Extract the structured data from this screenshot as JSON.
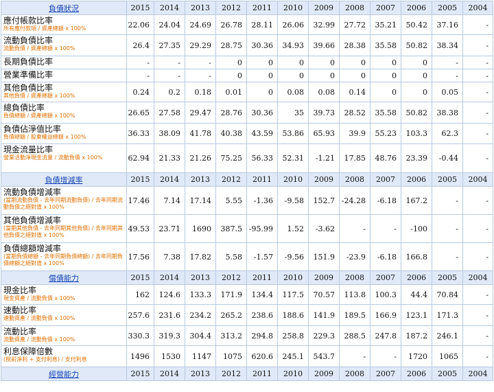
{
  "years": [
    "2015",
    "2014",
    "2013",
    "2012",
    "2011",
    "2010",
    "2009",
    "2008",
    "2007",
    "2006",
    "2005",
    "2004"
  ],
  "sections": [
    {
      "title": "負債狀況",
      "rows": [
        {
          "label": "應付帳款比率",
          "desc": "所有應付款項 / 資產總額 x 100%",
          "values": [
            "22.06",
            "24.04",
            "24.69",
            "26.78",
            "28.11",
            "26.06",
            "32.99",
            "27.72",
            "35.21",
            "50.42",
            "37.16",
            "-"
          ]
        },
        {
          "label": "流動負債比率",
          "desc": "流動負債 / 資產總額 x 100%",
          "values": [
            "26.4",
            "27.35",
            "29.29",
            "28.75",
            "30.36",
            "34.93",
            "39.66",
            "28.38",
            "35.58",
            "50.82",
            "38.34",
            "-"
          ]
        },
        {
          "label": "長期負債比率",
          "desc": "",
          "values": [
            "-",
            "-",
            "-",
            "0",
            "0",
            "0",
            "0",
            "0",
            "0",
            "0",
            "-",
            "-"
          ]
        },
        {
          "label": "營業準備比率",
          "desc": "",
          "values": [
            "-",
            "-",
            "-",
            "0",
            "0",
            "0",
            "0",
            "0",
            "0",
            "0",
            "-",
            "-"
          ]
        },
        {
          "label": "其他負債比率",
          "desc": "其他負債 / 資產總額 x 100%",
          "values": [
            "0.24",
            "0.2",
            "0.18",
            "0.01",
            "0",
            "0.08",
            "0.08",
            "0.14",
            "0",
            "0",
            "0.05",
            "-"
          ]
        },
        {
          "label": "總負債比率",
          "desc": "負債總額 / 資產總額 x 100%",
          "values": [
            "26.65",
            "27.58",
            "29.47",
            "28.76",
            "30.36",
            "35",
            "39.73",
            "28.52",
            "35.58",
            "50.82",
            "38.38",
            "-"
          ]
        },
        {
          "label": "負債佔淨值比率",
          "desc": "負債總額 / 股東權益總額 x 100%",
          "values": [
            "36.33",
            "38.09",
            "41.78",
            "40.38",
            "43.59",
            "53.86",
            "65.93",
            "39.9",
            "55.23",
            "103.3",
            "62.3",
            "-"
          ]
        },
        {
          "label": "現金流量比率",
          "desc": "營業活動淨現金流量 / 流動負債 x 100%",
          "values": [
            "62.94",
            "21.33",
            "21.26",
            "75.25",
            "56.33",
            "52.31",
            "-1.21",
            "17.85",
            "48.76",
            "23.39",
            "-0.44",
            "-"
          ]
        }
      ]
    },
    {
      "title": "負債增減率",
      "rows": [
        {
          "label": "流動負債增減率",
          "desc": "(當期流動負債 - 去年同期流動負債) / 去年同期流動負債之絕對值 x 100%",
          "values": [
            "17.46",
            "7.14",
            "17.14",
            "5.55",
            "-1.36",
            "-9.58",
            "152.7",
            "-24.28",
            "-6.18",
            "167.2",
            "-",
            "-"
          ]
        },
        {
          "label": "其他負債增減率",
          "desc": "(當期其他負債 - 去年同期其他負債) / 去年同期其他負債之絕對值 x 100%",
          "values": [
            "49.53",
            "23.71",
            "1690",
            "387.5",
            "-95.99",
            "1.52",
            "-3.62",
            "-",
            "-",
            "-100",
            "-",
            "-"
          ]
        },
        {
          "label": "負債總額增減率",
          "desc": "(當期負債總額 - 去年同期負債總額) / 去年同期負債總額之絕對值 x 100%",
          "values": [
            "17.56",
            "7.38",
            "17.82",
            "5.58",
            "-1.57",
            "-9.56",
            "151.9",
            "-23.9",
            "-6.18",
            "166.8",
            "-",
            "-"
          ]
        }
      ]
    },
    {
      "title": "償債能力",
      "rows": [
        {
          "label": "現金比率",
          "desc": "現金資產 / 流動負債 x 100%",
          "values": [
            "162",
            "124.6",
            "133.3",
            "171.9",
            "134.4",
            "117.5",
            "70.57",
            "113.8",
            "100.3",
            "44.4",
            "70.84",
            "-"
          ]
        },
        {
          "label": "速動比率",
          "desc": "速動資產 / 流動負債 x 100%",
          "values": [
            "257.6",
            "231.6",
            "234.2",
            "265.2",
            "238.6",
            "188.6",
            "141.9",
            "189.5",
            "166.9",
            "123.1",
            "171.3",
            "-"
          ]
        },
        {
          "label": "流動比率",
          "desc": "流動資產 / 流動負債 x 100%",
          "values": [
            "330.3",
            "319.3",
            "304.4",
            "313.2",
            "294.8",
            "258.8",
            "229.3",
            "288.5",
            "247.8",
            "187.2",
            "246.1",
            "-"
          ]
        },
        {
          "label": "利息保障倍數",
          "desc": "(稅前淨利 + 支付利息) / 支付利息",
          "values": [
            "1496",
            "1530",
            "1147",
            "1075",
            "620.6",
            "245.1",
            "543.7",
            "-",
            "-",
            "1720",
            "1065",
            "-"
          ]
        }
      ]
    },
    {
      "title": "經營能力",
      "rows": []
    }
  ]
}
